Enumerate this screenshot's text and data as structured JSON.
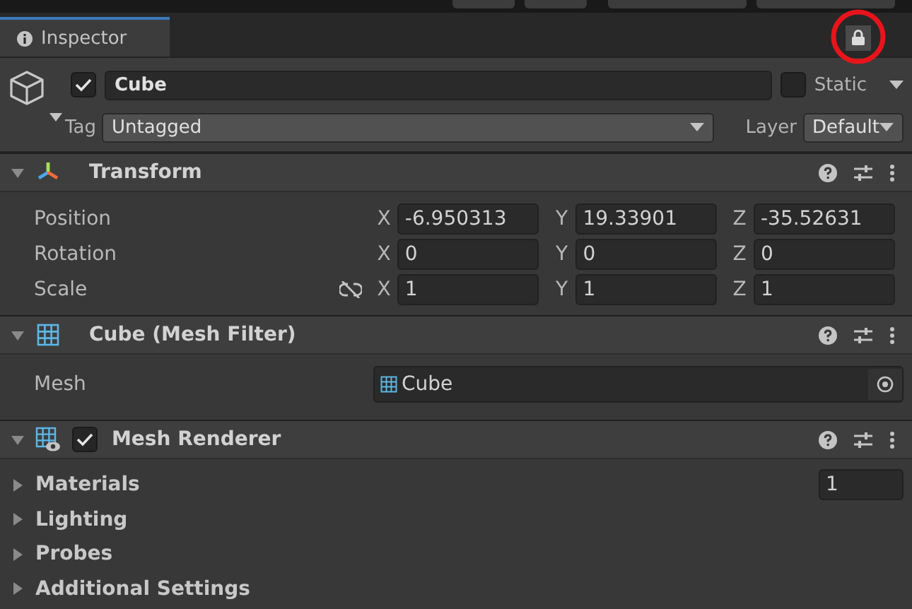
{
  "tab": {
    "label": "Inspector",
    "selected": true
  },
  "game_object": {
    "active": true,
    "name": "Cube",
    "static": false,
    "static_label": "Static",
    "tag_label": "Tag",
    "tag": "Untagged",
    "layer_label": "Layer",
    "layer": "Default"
  },
  "components": [
    {
      "kind": "transform",
      "title": "Transform",
      "expanded": true,
      "rows": [
        {
          "label": "Position",
          "unlinked": false,
          "fields": [
            {
              "axis": "X",
              "value": "-6.950313"
            },
            {
              "axis": "Y",
              "value": "19.33901"
            },
            {
              "axis": "Z",
              "value": "-35.52631"
            }
          ]
        },
        {
          "label": "Rotation",
          "unlinked": false,
          "fields": [
            {
              "axis": "X",
              "value": "0"
            },
            {
              "axis": "Y",
              "value": "0"
            },
            {
              "axis": "Z",
              "value": "0"
            }
          ]
        },
        {
          "label": "Scale",
          "unlinked": true,
          "fields": [
            {
              "axis": "X",
              "value": "1"
            },
            {
              "axis": "Y",
              "value": "1"
            },
            {
              "axis": "Z",
              "value": "1"
            }
          ]
        }
      ]
    },
    {
      "kind": "mesh_filter",
      "title": "Cube (Mesh Filter)",
      "expanded": true,
      "field": {
        "label": "Mesh",
        "value": "Cube"
      }
    },
    {
      "kind": "mesh_renderer",
      "title": "Mesh Renderer",
      "enabled": true,
      "expanded": true,
      "foldouts": [
        {
          "label": "Materials",
          "expanded": false,
          "value": "1"
        },
        {
          "label": "Lighting",
          "expanded": false
        },
        {
          "label": "Probes",
          "expanded": false
        },
        {
          "label": "Additional Settings",
          "expanded": false
        }
      ]
    }
  ]
}
